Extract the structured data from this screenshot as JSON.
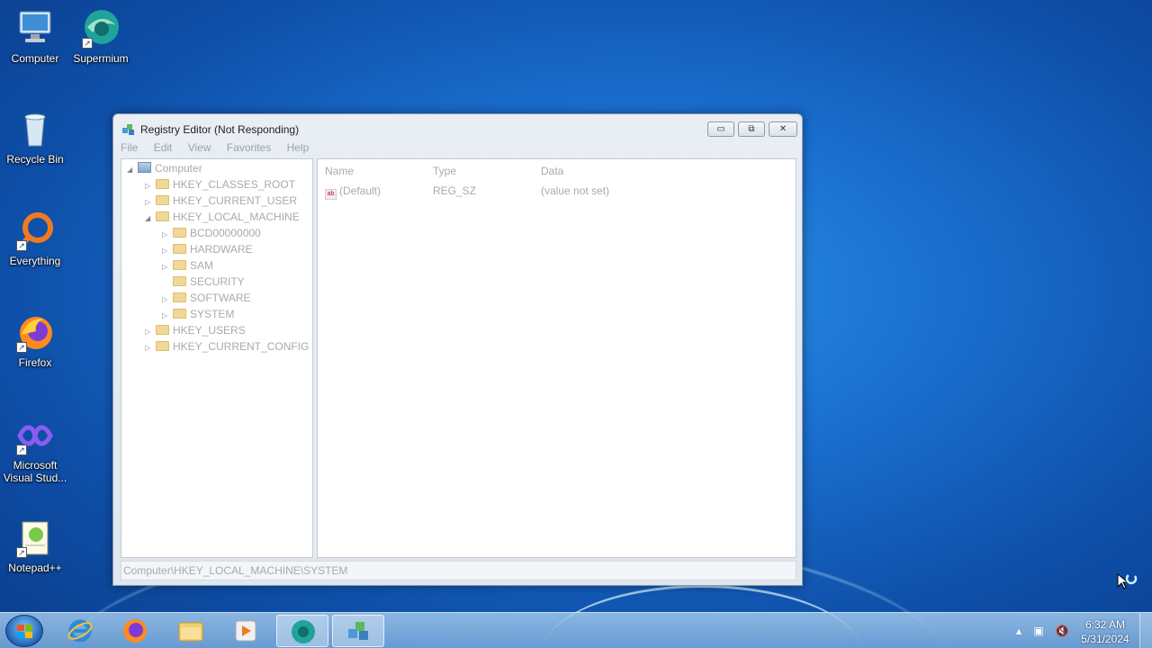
{
  "desktop": {
    "icons": [
      {
        "label": "Computer",
        "icon": "computer-icon"
      },
      {
        "label": "Supermium",
        "icon": "supermium-icon"
      },
      {
        "label": "Recycle Bin",
        "icon": "recycle-bin-icon"
      },
      {
        "label": "Everything",
        "icon": "everything-icon"
      },
      {
        "label": "Firefox",
        "icon": "firefox-icon"
      },
      {
        "label": "Microsoft Visual Stud...",
        "icon": "visual-studio-icon"
      },
      {
        "label": "Notepad++",
        "icon": "notepadpp-icon"
      }
    ]
  },
  "window": {
    "title": "Registry Editor (Not Responding)",
    "menu": [
      "File",
      "Edit",
      "View",
      "Favorites",
      "Help"
    ],
    "tree": {
      "root": "Computer",
      "items": [
        "HKEY_CLASSES_ROOT",
        "HKEY_CURRENT_USER",
        "HKEY_LOCAL_MACHINE",
        "BCD00000000",
        "HARDWARE",
        "SAM",
        "SECURITY",
        "SOFTWARE",
        "SYSTEM",
        "HKEY_USERS",
        "HKEY_CURRENT_CONFIG"
      ]
    },
    "columns": {
      "name": "Name",
      "type": "Type",
      "data": "Data"
    },
    "values": [
      {
        "name": "(Default)",
        "type": "REG_SZ",
        "data": "(value not set)"
      }
    ],
    "status_path": "Computer\\HKEY_LOCAL_MACHINE\\SYSTEM"
  },
  "taskbar": {
    "apps": [
      "internet-explorer-icon",
      "firefox-icon",
      "file-explorer-icon",
      "media-player-icon",
      "supermium-icon",
      "registry-editor-icon"
    ],
    "time": "6:32 AM",
    "date": "5/31/2024"
  },
  "colors": {
    "accent": "#1a6fcf",
    "muted_text": "#aaaaaa"
  }
}
